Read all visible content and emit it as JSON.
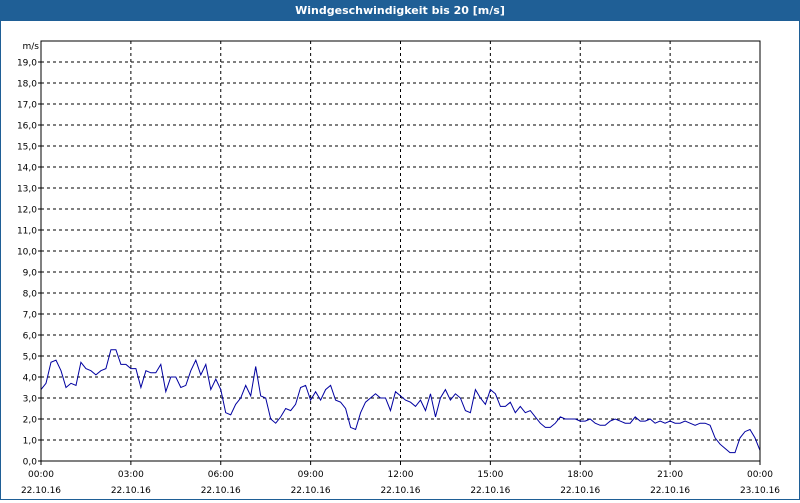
{
  "window": {
    "title": "Windgeschwindigkeit bis 20 [m/s]"
  },
  "colors": {
    "titlebar": "#1f5f96",
    "line": "#0000a0",
    "grid": "#000000"
  },
  "chart_data": {
    "type": "line",
    "title": "",
    "ylabel": "m/s",
    "xlabel": "",
    "ylim": [
      0,
      20
    ],
    "xlim": [
      "22.10.16 00:00",
      "23.10.16 00:00"
    ],
    "grid": true,
    "yticks": [
      "0,0",
      "1,0",
      "2,0",
      "3,0",
      "4,0",
      "5,0",
      "6,0",
      "7,0",
      "8,0",
      "9,0",
      "10,0",
      "11,0",
      "12,0",
      "13,0",
      "14,0",
      "15,0",
      "16,0",
      "17,0",
      "18,0",
      "19,0"
    ],
    "xticks": [
      {
        "time": "00:00",
        "date": "22.10.16"
      },
      {
        "time": "03:00",
        "date": "22.10.16"
      },
      {
        "time": "06:00",
        "date": "22.10.16"
      },
      {
        "time": "09:00",
        "date": "22.10.16"
      },
      {
        "time": "12:00",
        "date": "22.10.16"
      },
      {
        "time": "15:00",
        "date": "22.10.16"
      },
      {
        "time": "18:00",
        "date": "22.10.16"
      },
      {
        "time": "21:00",
        "date": "22.10.16"
      },
      {
        "time": "00:00",
        "date": "23.10.16"
      }
    ],
    "series": [
      {
        "x": [
          "00:00",
          "00:10",
          "00:20",
          "00:30",
          "00:40",
          "00:50",
          "01:00",
          "01:10",
          "01:20",
          "01:30",
          "01:40",
          "01:50",
          "02:00",
          "02:10",
          "02:20",
          "02:30",
          "02:40",
          "02:50",
          "03:00",
          "03:10",
          "03:20",
          "03:30",
          "03:40",
          "03:50",
          "04:00",
          "04:10",
          "04:20",
          "04:30",
          "04:40",
          "04:50",
          "05:00",
          "05:10",
          "05:20",
          "05:30",
          "05:40",
          "05:50",
          "06:00",
          "06:10",
          "06:20",
          "06:30",
          "06:40",
          "06:50",
          "07:00",
          "07:10",
          "07:20",
          "07:30",
          "07:40",
          "07:50",
          "08:00",
          "08:10",
          "08:20",
          "08:30",
          "08:40",
          "08:50",
          "09:00",
          "09:10",
          "09:20",
          "09:30",
          "09:40",
          "09:50",
          "10:00",
          "10:10",
          "10:20",
          "10:30",
          "10:40",
          "10:50",
          "11:00",
          "11:10",
          "11:20",
          "11:30",
          "11:40",
          "11:50",
          "12:00",
          "12:10",
          "12:20",
          "12:30",
          "12:40",
          "12:50",
          "13:00",
          "13:10",
          "13:20",
          "13:30",
          "13:40",
          "13:50",
          "14:00",
          "14:10",
          "14:20",
          "14:30",
          "14:40",
          "14:50",
          "15:00",
          "15:10",
          "15:20",
          "15:30",
          "15:40",
          "15:50",
          "16:00",
          "16:10",
          "16:20",
          "16:30",
          "16:40",
          "16:50",
          "17:00",
          "17:10",
          "17:20",
          "17:30",
          "17:40",
          "17:50",
          "18:00",
          "18:10",
          "18:20",
          "18:30",
          "18:40",
          "18:50",
          "19:00",
          "19:10",
          "19:20",
          "19:30",
          "19:40",
          "19:50",
          "20:00",
          "20:10",
          "20:20",
          "20:30",
          "20:40",
          "20:50",
          "21:00",
          "21:10",
          "21:20",
          "21:30",
          "21:40",
          "21:50",
          "22:00",
          "22:10",
          "22:20",
          "22:30",
          "22:40",
          "22:50",
          "23:00",
          "23:10",
          "23:20",
          "23:30",
          "23:40",
          "23:50",
          "00:00"
        ],
        "values": [
          3.4,
          3.7,
          4.7,
          4.8,
          4.3,
          3.5,
          3.7,
          3.6,
          4.7,
          4.4,
          4.3,
          4.1,
          4.3,
          4.4,
          5.3,
          5.3,
          4.6,
          4.6,
          4.4,
          4.4,
          3.5,
          4.3,
          4.2,
          4.2,
          4.6,
          3.3,
          4.0,
          4.0,
          3.5,
          3.6,
          4.3,
          4.8,
          4.1,
          4.6,
          3.4,
          3.9,
          3.4,
          2.3,
          2.2,
          2.7,
          3.0,
          3.6,
          3.1,
          4.5,
          3.1,
          3.0,
          2.0,
          1.8,
          2.1,
          2.5,
          2.4,
          2.7,
          3.5,
          3.6,
          2.9,
          3.3,
          2.9,
          3.4,
          3.6,
          2.9,
          2.8,
          2.5,
          1.6,
          1.5,
          2.3,
          2.8,
          3.0,
          3.2,
          3.0,
          3.0,
          2.4,
          3.3,
          3.1,
          2.9,
          2.8,
          2.6,
          2.9,
          2.4,
          3.2,
          2.1,
          3.0,
          3.4,
          2.9,
          3.2,
          3.0,
          2.4,
          2.3,
          3.4,
          3.0,
          2.7,
          3.4,
          3.2,
          2.6,
          2.6,
          2.8,
          2.3,
          2.6,
          2.3,
          2.4,
          2.1,
          1.8,
          1.6,
          1.6,
          1.8,
          2.1,
          2.0,
          2.0,
          2.0,
          1.9,
          1.9,
          2.0,
          1.8,
          1.7,
          1.7,
          1.9,
          2.0,
          1.9,
          1.8,
          1.8,
          2.1,
          1.9,
          1.9,
          2.0,
          1.8,
          1.9,
          1.8,
          1.9,
          1.8,
          1.8,
          1.9,
          1.8,
          1.7,
          1.8,
          1.8,
          1.7,
          1.1,
          0.8,
          0.6,
          0.4,
          0.4,
          1.1,
          1.4,
          1.5,
          1.1,
          0.5
        ]
      }
    ]
  }
}
